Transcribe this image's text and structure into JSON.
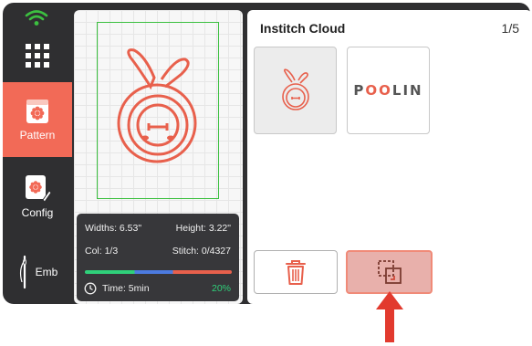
{
  "sidebar": {
    "items": [
      {
        "label": "",
        "icon": "grid-icon"
      },
      {
        "label": "Pattern",
        "icon": "pattern-icon",
        "active": true
      },
      {
        "label": "Config",
        "icon": "config-icon"
      },
      {
        "label": "Emb",
        "icon": "needle-icon"
      }
    ]
  },
  "status": {
    "wifi_icon": "wifi-icon"
  },
  "preview": {
    "width_text": "Widths: 6.53\"",
    "height_text": "Height: 3.22\"",
    "col_text": "Col: 1/3",
    "stitch_text": "Stitch: 0/4327",
    "time_text": "Time: 5min",
    "percent_text": "20%",
    "progress": 0.2
  },
  "cloud": {
    "title": "Institch Cloud",
    "page": "1/5",
    "thumbnails": [
      {
        "name": "bunny-design",
        "selected": true
      },
      {
        "name": "poolin-logo",
        "text": "POOLIN"
      }
    ]
  },
  "colors": {
    "accent": "#f26a57",
    "green": "#3cc040",
    "dark": "#2f2f31"
  }
}
